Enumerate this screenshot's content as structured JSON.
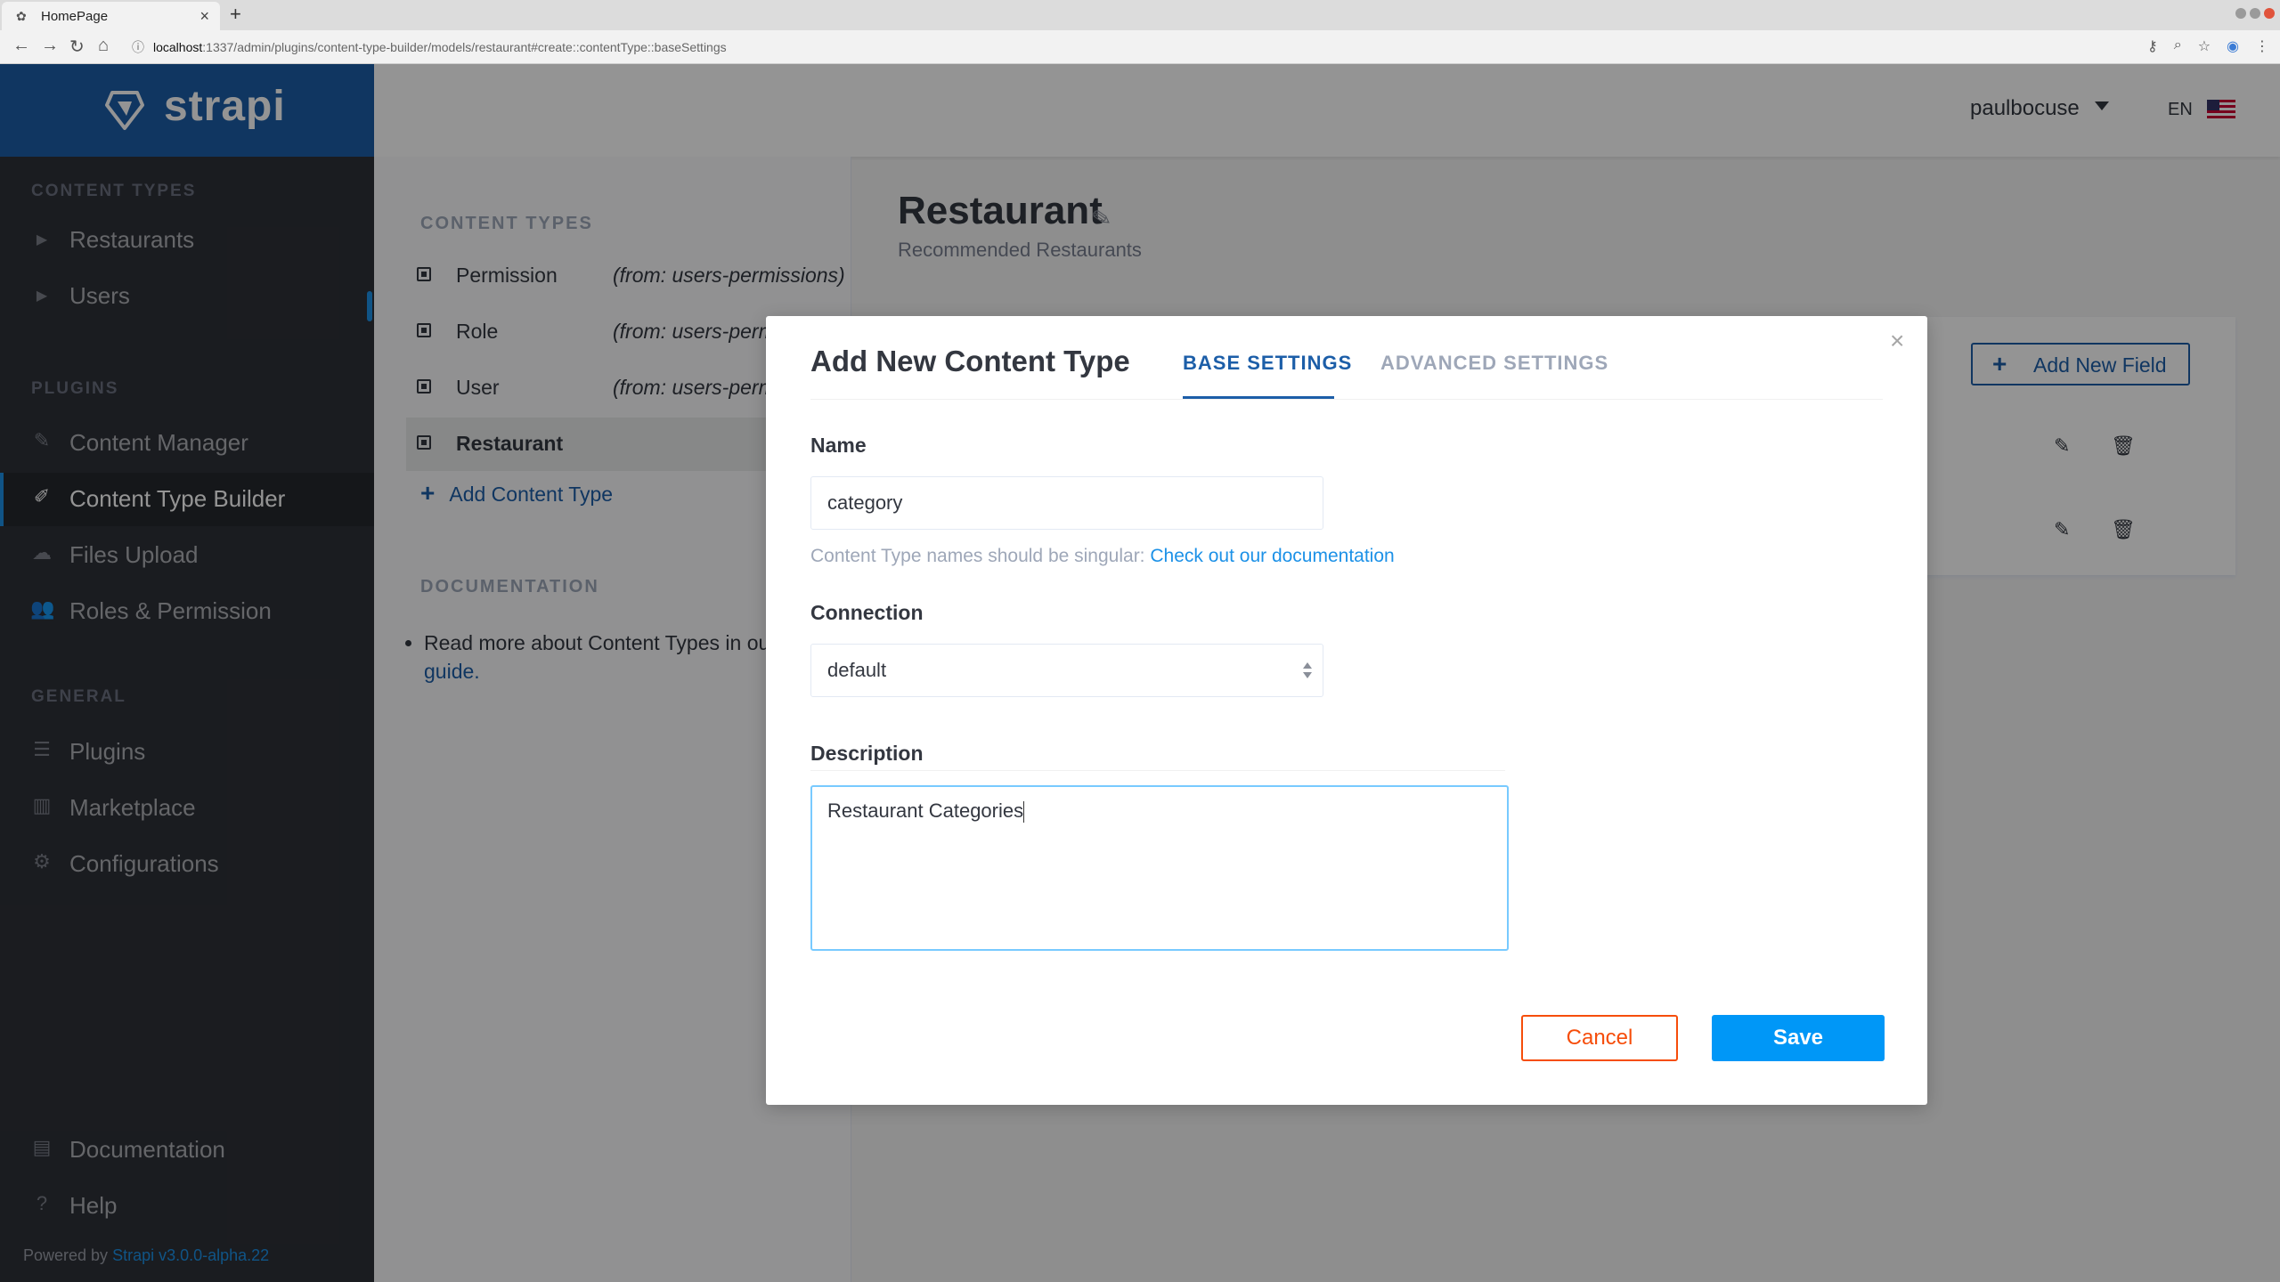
{
  "browser": {
    "tab_title": "HomePage",
    "url_host": "localhost",
    "url_path": ":1337/admin/plugins/content-type-builder/models/restaurant#create::contentType::baseSettings"
  },
  "brand": {
    "name": "strapi"
  },
  "sidebar": {
    "sections": [
      {
        "title": "CONTENT TYPES",
        "items": [
          {
            "label": "Restaurants",
            "icon": "caret-right-icon"
          },
          {
            "label": "Users",
            "icon": "caret-right-icon"
          }
        ]
      },
      {
        "title": "PLUGINS",
        "items": [
          {
            "label": "Content Manager",
            "icon": "pencil-icon"
          },
          {
            "label": "Content Type Builder",
            "icon": "paint-brush-icon",
            "active": true
          },
          {
            "label": "Files Upload",
            "icon": "cloud-upload-icon"
          },
          {
            "label": "Roles & Permission",
            "icon": "users-icon"
          }
        ]
      },
      {
        "title": "GENERAL",
        "items": [
          {
            "label": "Plugins",
            "icon": "list-icon"
          },
          {
            "label": "Marketplace",
            "icon": "basket-icon"
          },
          {
            "label": "Configurations",
            "icon": "gear-icon"
          }
        ]
      }
    ],
    "footer_items": [
      {
        "label": "Documentation",
        "icon": "book-icon"
      },
      {
        "label": "Help",
        "icon": "question-icon"
      }
    ],
    "powered_by": "Powered by",
    "version": "Strapi v3.0.0-alpha.22"
  },
  "header": {
    "user": "paulbocuse",
    "lang": "EN"
  },
  "content_types_panel": {
    "heading": "CONTENT TYPES",
    "items": [
      {
        "name": "Permission",
        "from": "(from: users-permissions)"
      },
      {
        "name": "Role",
        "from": "(from: users-permissions)"
      },
      {
        "name": "User",
        "from": "(from: users-permissions)"
      },
      {
        "name": "Restaurant",
        "from": "",
        "active": true
      }
    ],
    "add_label": "Add Content Type",
    "doc_heading": "DOCUMENTATION",
    "doc_text": "Read more about Content Types in our",
    "doc_link": "guide."
  },
  "main": {
    "title": "Restaurant",
    "subtitle": "Recommended Restaurants",
    "add_field_label": "Add New Field"
  },
  "modal": {
    "title": "Add New Content Type",
    "tabs": [
      "BASE SETTINGS",
      "ADVANCED SETTINGS"
    ],
    "name_label": "Name",
    "name_value": "category",
    "hint_text": "Content Type names should be singular:",
    "hint_link": "Check out our documentation",
    "connection_label": "Connection",
    "connection_value": "default",
    "description_label": "Description",
    "description_value": "Restaurant Categories",
    "cancel_label": "Cancel",
    "save_label": "Save"
  }
}
